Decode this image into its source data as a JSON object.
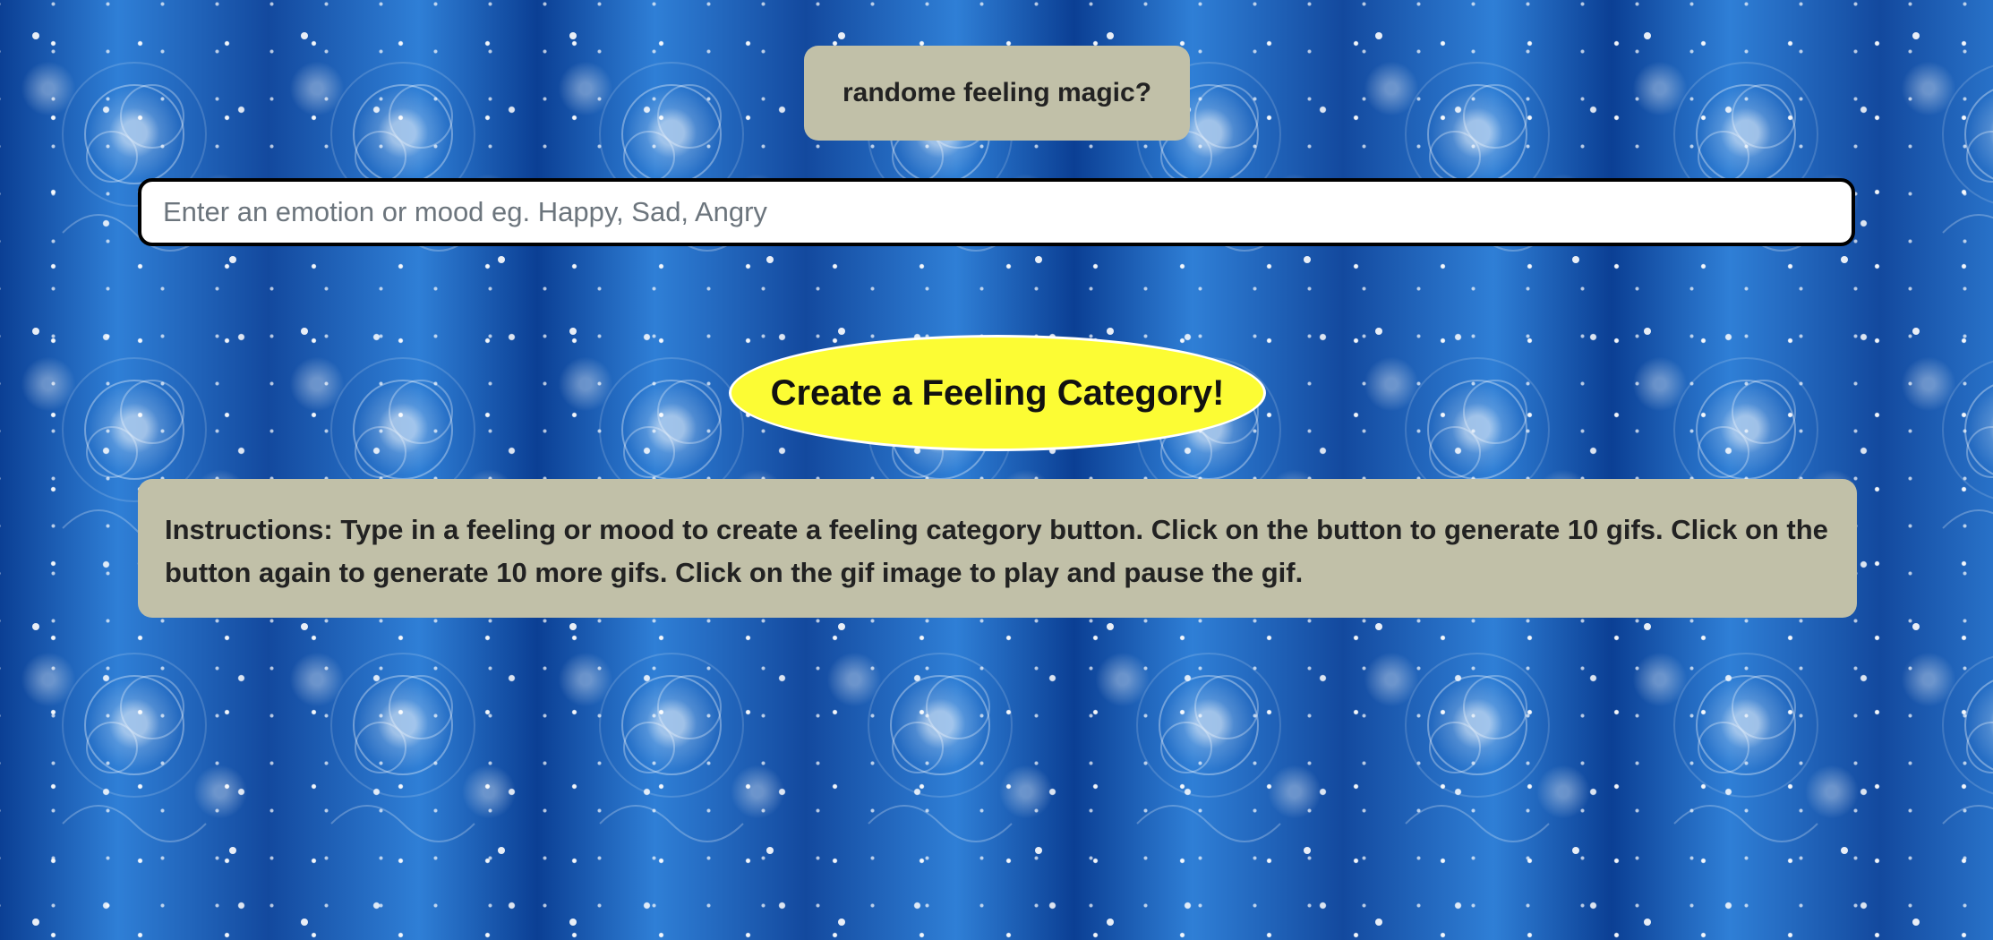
{
  "page": {
    "background_color": "#1d5fb8",
    "background_motif": "snowflake-swirl-pattern"
  },
  "header": {
    "title": "randome feeling magic?"
  },
  "search": {
    "value": "",
    "placeholder": "Enter an emotion or mood eg. Happy, Sad, Angry"
  },
  "actions": {
    "create_button_label": "Create a Feeling Category!",
    "create_button_color": "#fcfc34"
  },
  "instructions": {
    "text": "Instructions: Type in a feeling or mood to create a feeling category button. Click on the button to generate 10 gifs. Click on the button again to generate 10 more gifs. Click on the gif image to play and pause the gif."
  },
  "colors": {
    "panel": "#c1c0a8",
    "input_border": "#000000"
  }
}
